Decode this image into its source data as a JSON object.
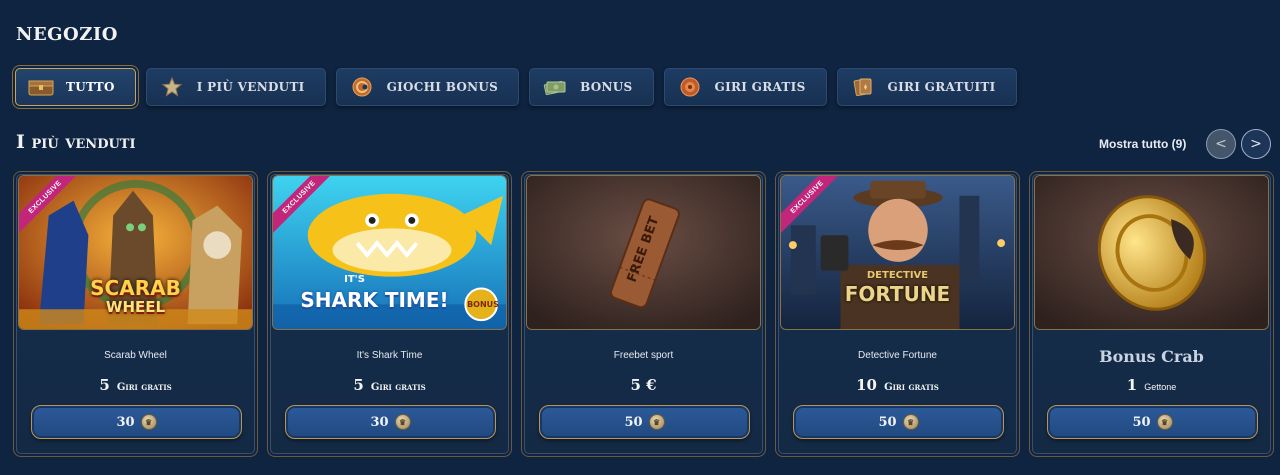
{
  "page": {
    "title": "NEGOZIO"
  },
  "tabs": [
    {
      "label": "TUTTO",
      "icon": "chest-icon",
      "active": true
    },
    {
      "label": "I PIÙ VENDUTI",
      "icon": "star-icon",
      "active": false
    },
    {
      "label": "GIOCHI BONUS",
      "icon": "bonus-game-icon",
      "active": false
    },
    {
      "label": "BONUS",
      "icon": "cash-icon",
      "active": false
    },
    {
      "label": "GIRI GRATIS",
      "icon": "spin-icon",
      "active": false
    },
    {
      "label": "GIRI GRATUITI",
      "icon": "cards-icon",
      "active": false
    }
  ],
  "section": {
    "title": "I più venduti",
    "show_all": "Mostra tutto (9)",
    "prev_label": "<",
    "next_label": ">"
  },
  "cards": [
    {
      "name": "Scarab Wheel",
      "reward_amount": "5",
      "reward_unit": "Giri gratis",
      "price": "30",
      "exclusive": "EXCLUSIVE",
      "art_title_1": "SCARAB",
      "art_title_2": "WHEEL"
    },
    {
      "name": "It's Shark Time",
      "reward_amount": "5",
      "reward_unit": "Giri gratis",
      "price": "30",
      "exclusive": "EXCLUSIVE",
      "art_title_1": "IT'S",
      "art_title_2": "SHARK TIME!",
      "art_badge": "BONUS"
    },
    {
      "name": "Freebet sport",
      "reward_amount": "5 €",
      "reward_unit": "",
      "price": "50",
      "art_title_1": "FREE BET"
    },
    {
      "name": "Detective Fortune",
      "reward_amount": "10",
      "reward_unit": "Giri gratis",
      "price": "50",
      "exclusive": "EXCLUSIVE",
      "art_title_1": "DETECTIVE",
      "art_title_2": "FORTUNE"
    },
    {
      "name": "Bonus Crab",
      "reward_amount": "1",
      "reward_unit": "Gettone",
      "price": "50"
    }
  ],
  "colors": {
    "background": "#0f2440",
    "gold_border": "#c9a45c",
    "button_blue": "#2c5a9a",
    "exclusive_pink": "#c2267a"
  }
}
